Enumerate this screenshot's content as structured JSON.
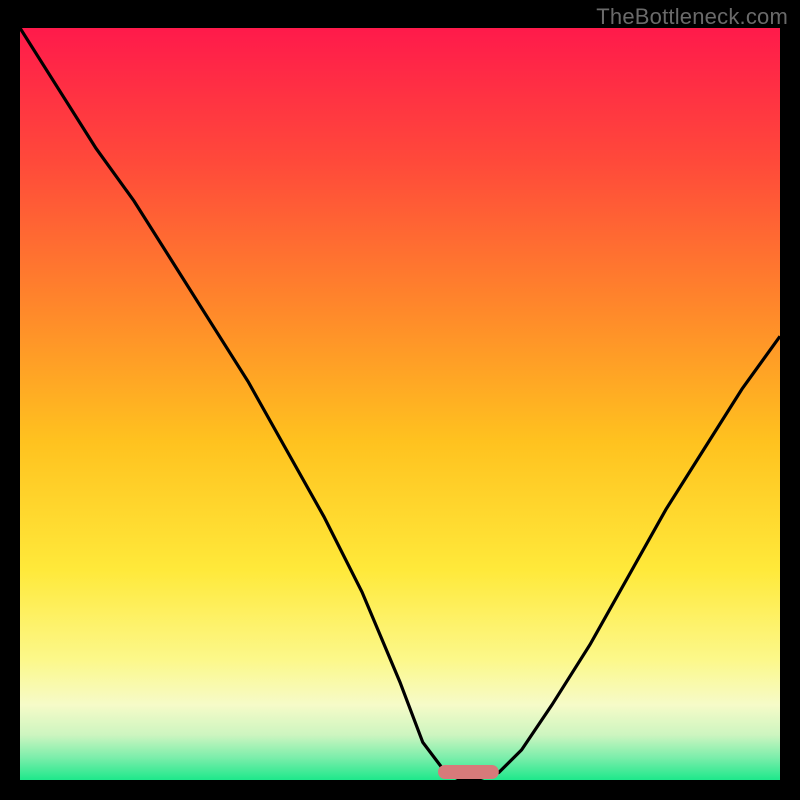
{
  "watermark": "TheBottleneck.com",
  "chart_data": {
    "type": "line",
    "title": "",
    "xlabel": "",
    "ylabel": "",
    "xlim": [
      0,
      100
    ],
    "ylim": [
      0,
      100
    ],
    "grid": false,
    "series": [
      {
        "name": "bottleneck-curve",
        "x": [
          0,
          5,
          10,
          15,
          20,
          25,
          30,
          35,
          40,
          45,
          50,
          53,
          56,
          58,
          60,
          63,
          66,
          70,
          75,
          80,
          85,
          90,
          95,
          100
        ],
        "y": [
          100,
          92,
          84,
          77,
          69,
          61,
          53,
          44,
          35,
          25,
          13,
          5,
          1,
          0,
          0,
          1,
          4,
          10,
          18,
          27,
          36,
          44,
          52,
          59
        ]
      }
    ],
    "marker": {
      "x_center": 59,
      "x_width": 8,
      "color": "#d77a7a"
    },
    "gradient_stops": [
      {
        "offset": 0.0,
        "color": "#ff1a4b"
      },
      {
        "offset": 0.18,
        "color": "#ff4a3a"
      },
      {
        "offset": 0.38,
        "color": "#ff8a2a"
      },
      {
        "offset": 0.55,
        "color": "#ffc21f"
      },
      {
        "offset": 0.72,
        "color": "#ffe93a"
      },
      {
        "offset": 0.84,
        "color": "#fcf88a"
      },
      {
        "offset": 0.9,
        "color": "#f6fbc8"
      },
      {
        "offset": 0.94,
        "color": "#cdf5c0"
      },
      {
        "offset": 0.97,
        "color": "#7ceeab"
      },
      {
        "offset": 1.0,
        "color": "#1ee88b"
      }
    ]
  }
}
